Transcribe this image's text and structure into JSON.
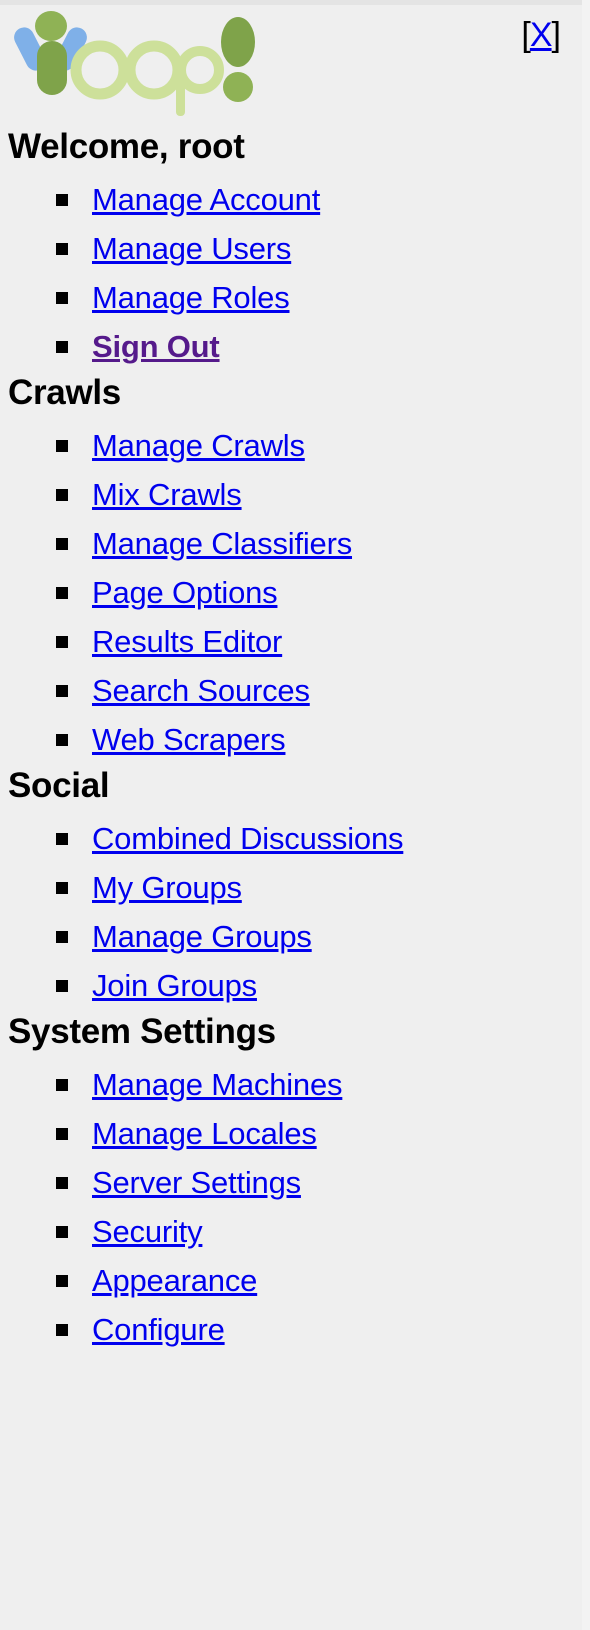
{
  "header": {
    "logo_alt": "Yioop",
    "logo_text": "Yioop!",
    "close_bracket_open": "[",
    "close_label": "X",
    "close_bracket_close": "]"
  },
  "sections": [
    {
      "heading": "Welcome, root",
      "items": [
        {
          "label": "Manage Account",
          "state": "link"
        },
        {
          "label": "Manage Users",
          "state": "link"
        },
        {
          "label": "Manage Roles",
          "state": "link"
        },
        {
          "label": "Sign Out",
          "state": "visited"
        }
      ]
    },
    {
      "heading": "Crawls",
      "items": [
        {
          "label": "Manage Crawls",
          "state": "link"
        },
        {
          "label": "Mix Crawls",
          "state": "link"
        },
        {
          "label": "Manage Classifiers",
          "state": "link"
        },
        {
          "label": "Page Options",
          "state": "link"
        },
        {
          "label": "Results Editor",
          "state": "link"
        },
        {
          "label": "Search Sources",
          "state": "link"
        },
        {
          "label": "Web Scrapers",
          "state": "link"
        }
      ]
    },
    {
      "heading": "Social",
      "items": [
        {
          "label": "Combined Discussions",
          "state": "link"
        },
        {
          "label": "My Groups",
          "state": "link"
        },
        {
          "label": "Manage Groups",
          "state": "link"
        },
        {
          "label": "Join Groups",
          "state": "link"
        }
      ]
    },
    {
      "heading": "System Settings",
      "items": [
        {
          "label": "Manage Machines",
          "state": "link"
        },
        {
          "label": "Manage Locales",
          "state": "link"
        },
        {
          "label": "Server Settings",
          "state": "link"
        },
        {
          "label": "Security",
          "state": "link"
        },
        {
          "label": "Appearance",
          "state": "link"
        },
        {
          "label": "Configure",
          "state": "link"
        }
      ]
    }
  ],
  "colors": {
    "background": "#efefef",
    "link": "#0000ee",
    "visited_link": "#551a8b",
    "heading": "#000000",
    "logo_green_dark": "#7fa34a",
    "logo_green_light": "#cde09a",
    "logo_blue": "#7fb0e8"
  }
}
